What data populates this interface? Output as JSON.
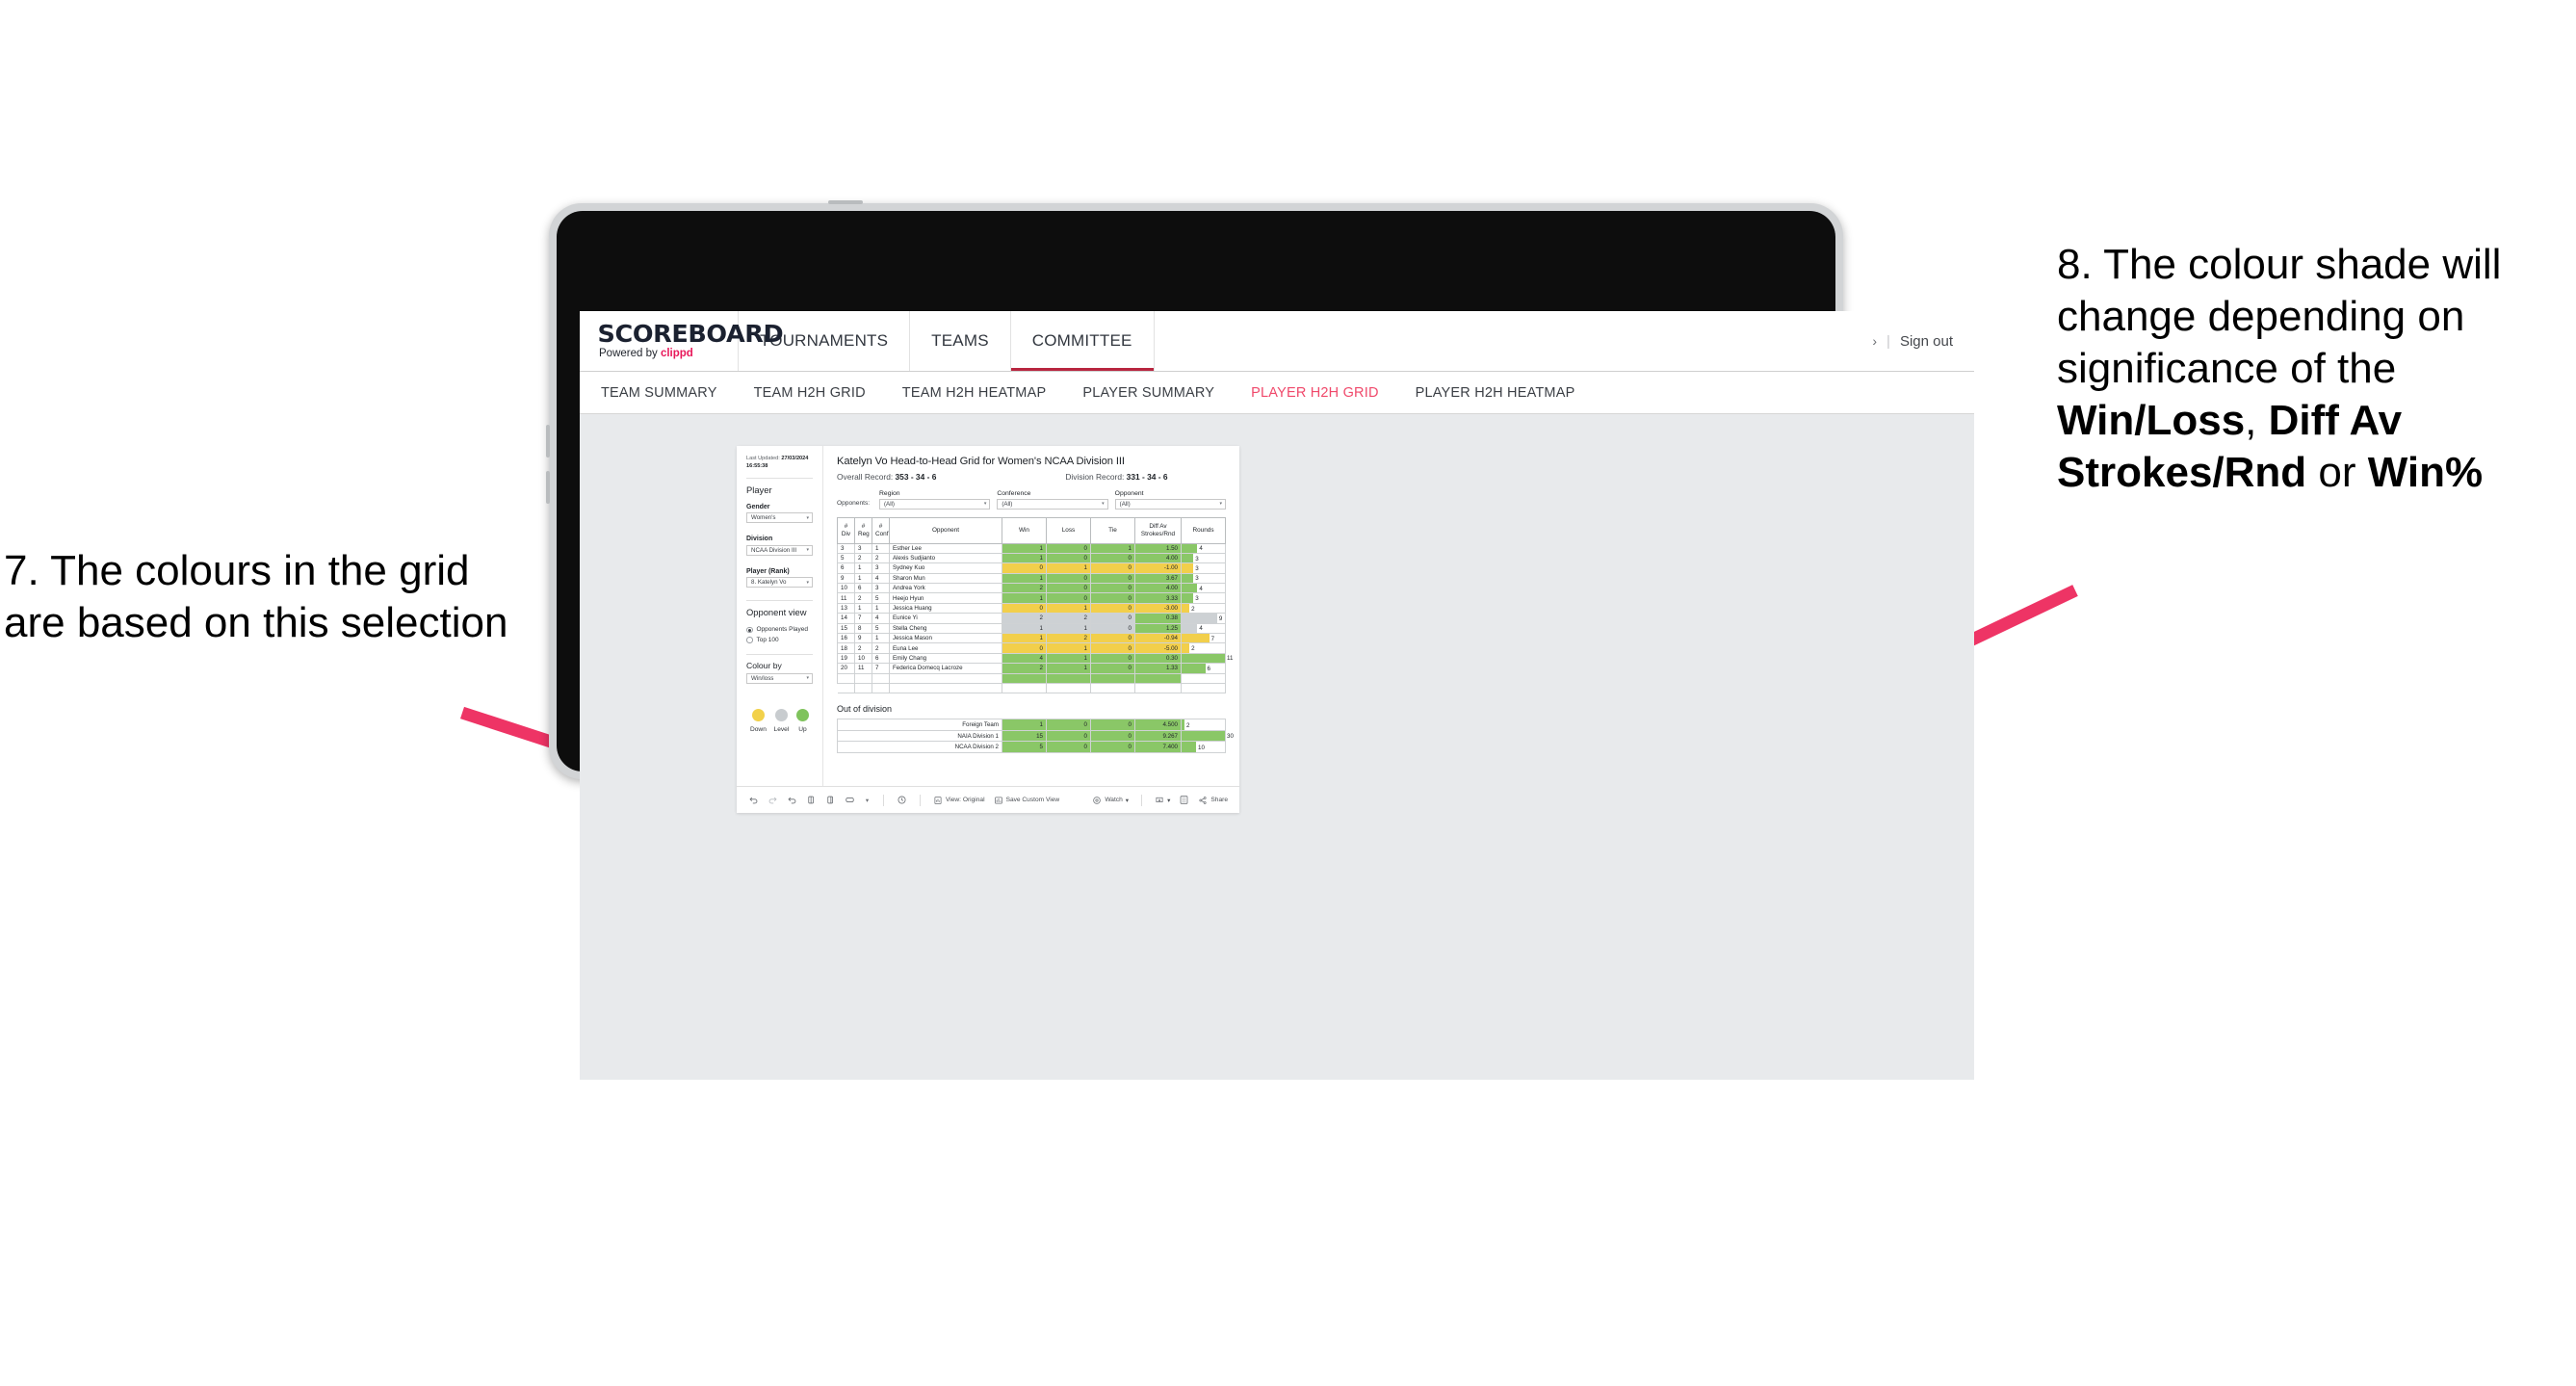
{
  "annotations": {
    "left": {
      "text": "7. The colours in the grid are based on this selection"
    },
    "right": {
      "line1": "8. The colour shade will change depending on significance of the ",
      "bold1": "Win/Loss",
      "mid1": ", ",
      "bold2": "Diff Av Strokes/Rnd",
      "mid2": " or ",
      "bold3": "Win%"
    }
  },
  "app": {
    "logo_main": "SCOREBOARD",
    "logo_sub_prefix": "Powered by ",
    "logo_sub_brand": "clippd",
    "top_nav": [
      {
        "label": "TOURNAMENTS",
        "active": false
      },
      {
        "label": "TEAMS",
        "active": false
      },
      {
        "label": "COMMITTEE",
        "active": true
      }
    ],
    "header_right": {
      "chevron": "›",
      "divider": "|",
      "sign_out": "Sign out"
    },
    "sub_nav": [
      {
        "label": "TEAM SUMMARY",
        "active": false
      },
      {
        "label": "TEAM H2H GRID",
        "active": false
      },
      {
        "label": "TEAM H2H HEATMAP",
        "active": false
      },
      {
        "label": "PLAYER SUMMARY",
        "active": false
      },
      {
        "label": "PLAYER H2H GRID",
        "active": true
      },
      {
        "label": "PLAYER H2H HEATMAP",
        "active": false
      }
    ]
  },
  "filters": {
    "last_updated_label": "Last Updated: ",
    "last_updated_date": "27/03/2024",
    "last_updated_time": "16:55:38",
    "player_group_title": "Player",
    "gender_label": "Gender",
    "gender_value": "Women's",
    "division_label": "Division",
    "division_value": "NCAA Division III",
    "player_rank_label": "Player (Rank)",
    "player_rank_value": "8. Katelyn Vo",
    "opponent_view_title": "Opponent view",
    "opponent_view_options": [
      {
        "label": "Opponents Played",
        "selected": true
      },
      {
        "label": "Top 100",
        "selected": false
      }
    ],
    "colour_by_label": "Colour by",
    "colour_by_value": "Win/loss",
    "legend": [
      {
        "label": "Down",
        "color": "#f2d14a"
      },
      {
        "label": "Level",
        "color": "#c8cccf"
      },
      {
        "label": "Up",
        "color": "#7fc35c"
      }
    ],
    "caret": "▾"
  },
  "viz": {
    "title": "Katelyn Vo Head-to-Head Grid for Women's NCAA Division III",
    "overall_record_label": "Overall Record: ",
    "overall_record_value": "353 - 34 - 6",
    "division_record_label": "Division Record: ",
    "division_record_value": "331 - 34 - 6",
    "opponents_label": "Opponents:",
    "opponent_filters": [
      {
        "label": "Region",
        "value": "(All)"
      },
      {
        "label": "Conference",
        "value": "(All)"
      },
      {
        "label": "Opponent",
        "value": "(All)"
      }
    ],
    "out_of_division_title": "Out of division"
  },
  "chart_data": {
    "type": "table",
    "title": "Katelyn Vo Head-to-Head Grid for Women's NCAA Division III",
    "columns": [
      "# Div",
      "# Reg",
      "# Conf",
      "Opponent",
      "Win",
      "Loss",
      "Tie",
      "Diff Av Strokes/Rnd",
      "Rounds"
    ],
    "column_headers_multiline": [
      {
        "l1": "#",
        "l2": "Div"
      },
      {
        "l1": "#",
        "l2": "Reg"
      },
      {
        "l1": "#",
        "l2": "Conf"
      },
      {
        "l1": "Opponent",
        "l2": ""
      },
      {
        "l1": "Win",
        "l2": ""
      },
      {
        "l1": "Loss",
        "l2": ""
      },
      {
        "l1": "Tie",
        "l2": ""
      },
      {
        "l1": "Diff Av",
        "l2": "Strokes/Rnd"
      },
      {
        "l1": "Rounds",
        "l2": ""
      }
    ],
    "rounds_max": 11,
    "rows": [
      {
        "div": "3",
        "reg": "3",
        "conf": "1",
        "opponent": "Esther Lee",
        "win": "1",
        "loss": "0",
        "tie": "1",
        "diff": "1.50",
        "rounds": "4",
        "color": "#8ac767"
      },
      {
        "div": "5",
        "reg": "2",
        "conf": "2",
        "opponent": "Alexis Sudjianto",
        "win": "1",
        "loss": "0",
        "tie": "0",
        "diff": "4.00",
        "rounds": "3",
        "color": "#8ac767"
      },
      {
        "div": "6",
        "reg": "1",
        "conf": "3",
        "opponent": "Sydney Kuo",
        "win": "0",
        "loss": "1",
        "tie": "0",
        "diff": "-1.00",
        "rounds": "3",
        "color": "#f2cf4b"
      },
      {
        "div": "9",
        "reg": "1",
        "conf": "4",
        "opponent": "Sharon Mun",
        "win": "1",
        "loss": "0",
        "tie": "0",
        "diff": "3.67",
        "rounds": "3",
        "color": "#8ac767"
      },
      {
        "div": "10",
        "reg": "6",
        "conf": "3",
        "opponent": "Andrea York",
        "win": "2",
        "loss": "0",
        "tie": "0",
        "diff": "4.00",
        "rounds": "4",
        "color": "#8ac767"
      },
      {
        "div": "11",
        "reg": "2",
        "conf": "5",
        "opponent": "Heejo Hyun",
        "win": "1",
        "loss": "0",
        "tie": "0",
        "diff": "3.33",
        "rounds": "3",
        "color": "#8ac767"
      },
      {
        "div": "13",
        "reg": "1",
        "conf": "1",
        "opponent": "Jessica Huang",
        "win": "0",
        "loss": "1",
        "tie": "0",
        "diff": "-3.00",
        "rounds": "2",
        "color": "#f2cf4b"
      },
      {
        "div": "14",
        "reg": "7",
        "conf": "4",
        "opponent": "Eunice Yi",
        "win": "2",
        "loss": "2",
        "tie": "0",
        "diff": "0.38",
        "rounds": "9",
        "color": "#cdd1d4",
        "diff_color": "#8ac767"
      },
      {
        "div": "15",
        "reg": "8",
        "conf": "5",
        "opponent": "Stella Cheng",
        "win": "1",
        "loss": "1",
        "tie": "0",
        "diff": "1.25",
        "rounds": "4",
        "color": "#cdd1d4",
        "diff_color": "#8ac767"
      },
      {
        "div": "16",
        "reg": "9",
        "conf": "1",
        "opponent": "Jessica Mason",
        "win": "1",
        "loss": "2",
        "tie": "0",
        "diff": "-0.94",
        "rounds": "7",
        "color": "#f2cf4b"
      },
      {
        "div": "18",
        "reg": "2",
        "conf": "2",
        "opponent": "Euna Lee",
        "win": "0",
        "loss": "1",
        "tie": "0",
        "diff": "-5.00",
        "rounds": "2",
        "color": "#f2cf4b"
      },
      {
        "div": "19",
        "reg": "10",
        "conf": "6",
        "opponent": "Emily Chang",
        "win": "4",
        "loss": "1",
        "tie": "0",
        "diff": "0.30",
        "rounds": "11",
        "color": "#8ac767"
      },
      {
        "div": "20",
        "reg": "11",
        "conf": "7",
        "opponent": "Federica Domecq Lacroze",
        "win": "2",
        "loss": "1",
        "tie": "0",
        "diff": "1.33",
        "rounds": "6",
        "color": "#8ac767"
      }
    ],
    "out_of_division": {
      "rounds_max": 30,
      "rows": [
        {
          "name": "Foreign Team",
          "win": "1",
          "loss": "0",
          "tie": "0",
          "diff": "4.500",
          "rounds": "2",
          "color": "#8ac767"
        },
        {
          "name": "NAIA Division 1",
          "win": "15",
          "loss": "0",
          "tie": "0",
          "diff": "9.267",
          "rounds": "30",
          "color": "#8ac767"
        },
        {
          "name": "NCAA Division 2",
          "win": "5",
          "loss": "0",
          "tie": "0",
          "diff": "7.400",
          "rounds": "10",
          "color": "#8ac767"
        }
      ]
    }
  },
  "toolbar": {
    "view_label": "View: Original",
    "save_label": "Save Custom View",
    "watch_label": "Watch",
    "share_label": "Share",
    "caret": "▾"
  }
}
